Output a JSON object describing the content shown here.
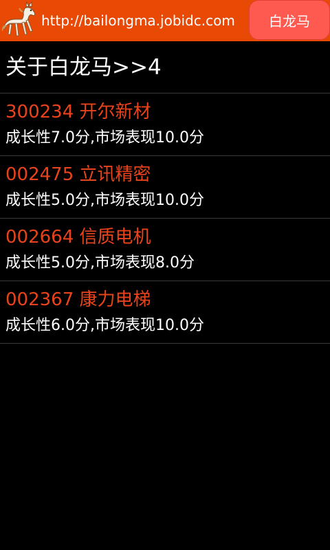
{
  "header": {
    "url": "http://bailongma.jobidc.com",
    "brand_label": "白龙马",
    "logo_icon": "white-horse-logo-icon",
    "bar_color": "#e84a06",
    "button_color": "#ff5a4f"
  },
  "page": {
    "title": "关于白龙马>>4"
  },
  "list": {
    "items": [
      {
        "title": "300234 开尔新材",
        "subtitle": "成长性7.0分,市场表现10.0分"
      },
      {
        "title": "002475 立讯精密",
        "subtitle": "成长性5.0分,市场表现10.0分"
      },
      {
        "title": "002664 信质电机",
        "subtitle": "成长性5.0分,市场表现8.0分"
      },
      {
        "title": "002367 康力电梯",
        "subtitle": "成长性6.0分,市场表现10.0分"
      }
    ],
    "title_color": "#e8431b",
    "subtitle_color": "#ffffff"
  }
}
